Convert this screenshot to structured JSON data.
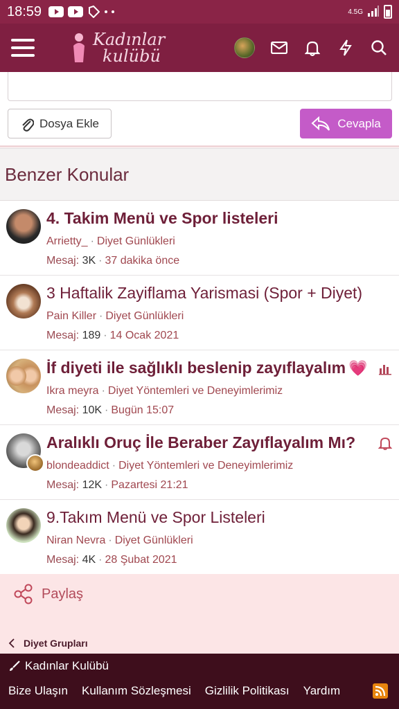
{
  "status_bar": {
    "time": "18:59",
    "network": "4.5G"
  },
  "header": {
    "logo_line1": "Kadınlar",
    "logo_line2": "kulübü"
  },
  "reply": {
    "attach_label": "Dosya Ekle",
    "reply_label": "Cevapla"
  },
  "similar": {
    "heading": "Benzer Konular",
    "threads": [
      {
        "title": "4. Takim Menü ve Spor listeleri",
        "author": "Arrietty_",
        "forum": "Diyet Günlükleri",
        "messages_label": "Mesaj:",
        "messages": "3K",
        "time": "37 dakika önce"
      },
      {
        "title": "3 Haftalik Zayiflama Yarismasi (Spor + Diyet)",
        "author": "Pain Killer",
        "forum": "Diyet Günlükleri",
        "messages_label": "Mesaj:",
        "messages": "189",
        "time": "14 Ocak 2021"
      },
      {
        "title": "İf diyeti ile sağlıklı beslenip zayıflayalım",
        "author": "Ikra meyra",
        "forum": "Diyet Yöntemleri ve Deneyimlerimiz",
        "messages_label": "Mesaj:",
        "messages": "10K",
        "time": "Bugün 15:07"
      },
      {
        "title": "Aralıklı Oruç İle Beraber Zayıflayalım Mı?",
        "author": "blondeaddict",
        "forum": "Diyet Yöntemleri ve Deneyimlerimiz",
        "messages_label": "Mesaj:",
        "messages": "12K",
        "time": "Pazartesi 21:21"
      },
      {
        "title": "9.Takım Menü ve Spor Listeleri",
        "author": "Niran Nevra",
        "forum": "Diyet Günlükleri",
        "messages_label": "Mesaj:",
        "messages": "4K",
        "time": "28 Şubat 2021"
      }
    ]
  },
  "share": {
    "label": "Paylaş"
  },
  "breadcrumb": {
    "label": "Diyet Grupları"
  },
  "footer": {
    "brand": "Kadınlar Kulübü",
    "links": [
      "Bize Ulaşın",
      "Kullanım Sözleşmesi",
      "Gizlilik Politikası",
      "Yardım"
    ]
  },
  "colors": {
    "header": "#7f1f41",
    "accent": "#c45bc8",
    "footer": "#3e0e1c"
  }
}
